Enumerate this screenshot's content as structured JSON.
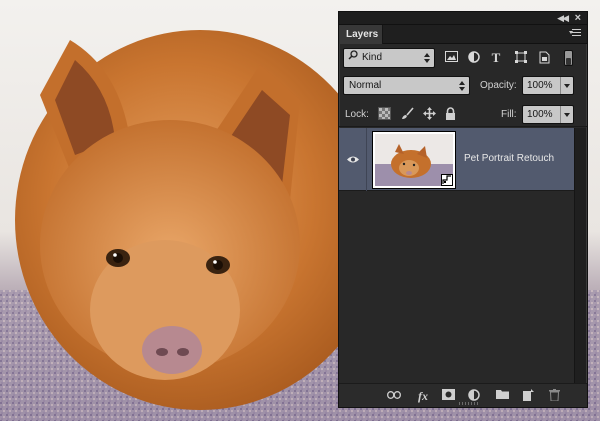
{
  "panel": {
    "title_tab": "Layers",
    "filter": {
      "kind_label": "Kind",
      "filter_icons": [
        "pixel-filter-icon",
        "adjustment-filter-icon",
        "type-filter-icon",
        "shape-filter-icon",
        "smart-object-filter-icon"
      ]
    },
    "blend": {
      "mode": "Normal",
      "opacity_label": "Opacity:",
      "opacity_value": "100%"
    },
    "lock": {
      "label": "Lock:",
      "fill_label": "Fill:",
      "fill_value": "100%"
    },
    "layers": [
      {
        "name": "Pet Portrait Retouch",
        "visible": true,
        "selected": true,
        "type": "smart-object"
      }
    ],
    "bottom_icons": [
      "link-icon",
      "fx-icon",
      "mask-icon",
      "adjustment-icon",
      "folder-icon",
      "new-layer-icon",
      "trash-icon"
    ],
    "fx_label": "fx"
  },
  "colors": {
    "panel_bg": "#282828",
    "selected_row": "#525a6e",
    "field_bg": "#c8c8c8"
  }
}
